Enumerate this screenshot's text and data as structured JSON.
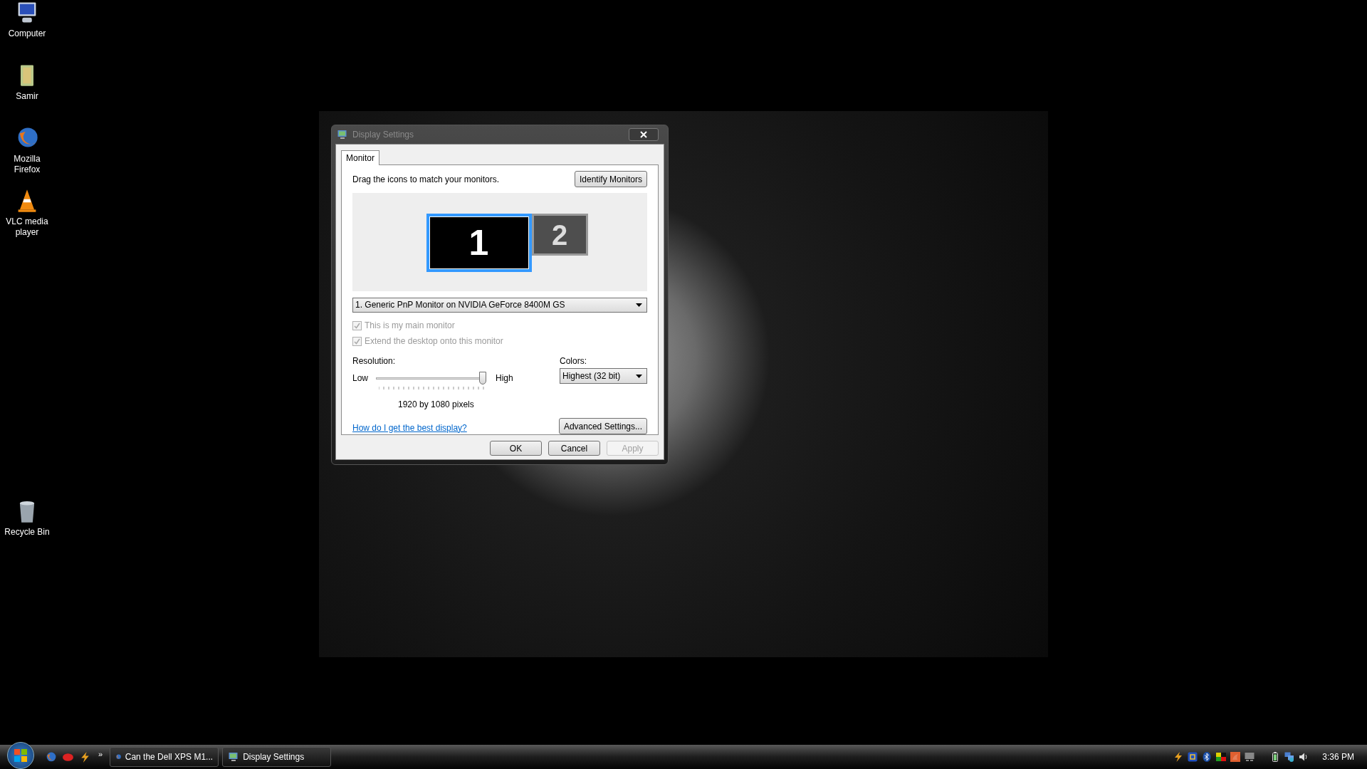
{
  "desktop_icons": [
    {
      "kind": "computer",
      "label": "Computer"
    },
    {
      "kind": "folder",
      "label": "Samir"
    },
    {
      "kind": "browser",
      "label": "Mozilla Firefox"
    },
    {
      "kind": "cone",
      "label": "VLC media player"
    },
    {
      "kind": "bin",
      "label": "Recycle Bin"
    }
  ],
  "dialog": {
    "title": "Display Settings",
    "tabs": [
      {
        "label": "Monitor",
        "selected": true
      }
    ],
    "instruction": "Drag the icons to match your monitors.",
    "identify_button": "Identify Monitors",
    "monitors": [
      {
        "label": "1",
        "selected": true
      },
      {
        "label": "2",
        "selected": false
      }
    ],
    "monitor_select": {
      "value": "1. Generic PnP Monitor on NVIDIA GeForce 8400M GS"
    },
    "checkboxes": [
      {
        "label": "This is my main monitor",
        "checked": true,
        "disabled": true
      },
      {
        "label": "Extend the desktop onto this monitor",
        "checked": true,
        "disabled": true
      }
    ],
    "resolution": {
      "label": "Resolution:",
      "low": "Low",
      "high": "High",
      "level": 0.97,
      "reading": "1920 by 1080 pixels"
    },
    "colors": {
      "label": "Colors:",
      "value": "Highest (32 bit)"
    },
    "help_link": "How do I get the best display?",
    "advanced_button": "Advanced Settings...",
    "buttons": [
      {
        "label": "OK",
        "disabled": false
      },
      {
        "label": "Cancel",
        "disabled": false
      },
      {
        "label": "Apply",
        "disabled": true
      }
    ]
  },
  "taskbar": {
    "quick_launch": [
      {
        "kind": "browser"
      },
      {
        "kind": "chat"
      },
      {
        "kind": "bolt"
      }
    ],
    "overflow": "»",
    "tasks": [
      {
        "kind": "browser",
        "label": "Can the Dell XPS M1..."
      },
      {
        "kind": "display",
        "label": "Display Settings"
      }
    ],
    "tray": [
      {
        "kind": "bolt"
      },
      {
        "kind": "sync"
      },
      {
        "kind": "bluetooth"
      },
      {
        "kind": "blocks"
      },
      {
        "kind": "flame"
      },
      {
        "kind": "screen"
      },
      {
        "kind": "battery"
      },
      {
        "kind": "network"
      },
      {
        "kind": "speaker"
      }
    ],
    "clock": "3:36 PM"
  }
}
